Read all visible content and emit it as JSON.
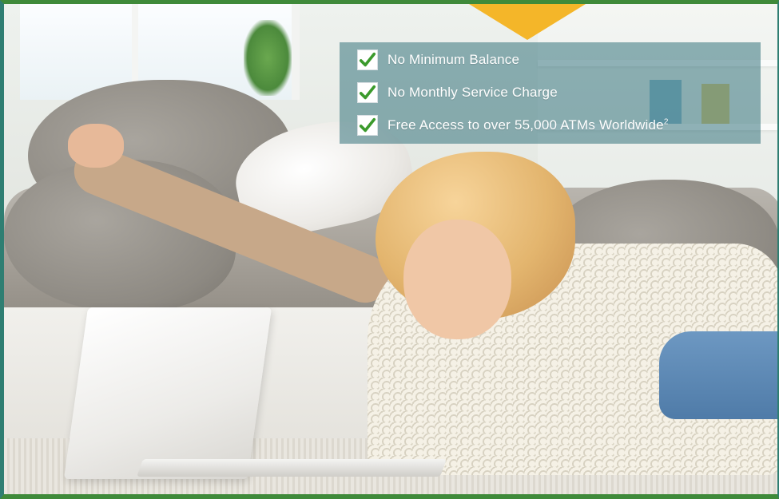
{
  "features": [
    {
      "text": "No Minimum Balance",
      "icon": "checkmark-icon"
    },
    {
      "text": "No Monthly Service Charge",
      "icon": "checkmark-icon"
    },
    {
      "text": "Free Access to over 55,000 ATMs Worldwide",
      "footnote": "2",
      "icon": "checkmark-icon"
    }
  ],
  "colors": {
    "border_green": "#3f8a3a",
    "border_teal": "#2f7e72",
    "accent_yellow": "#f4b629",
    "check_green": "#3b9a2c",
    "panel_teal": "#2c6e76"
  }
}
